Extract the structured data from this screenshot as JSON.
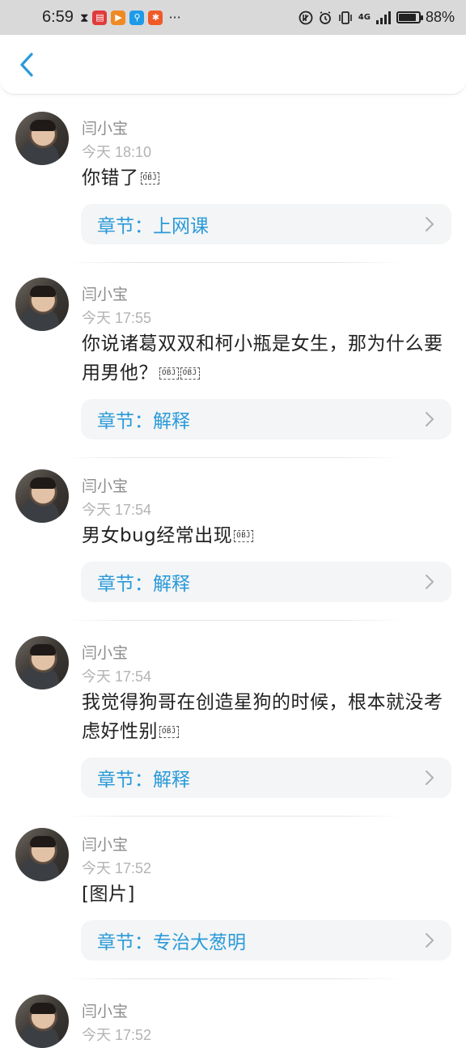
{
  "status_bar": {
    "time": "6:59",
    "app_icons": [
      {
        "name": "hourglass-icon",
        "color": "#222222"
      },
      {
        "name": "book-app-icon",
        "color": "#e03b3b"
      },
      {
        "name": "video-app-icon",
        "color": "#f08a24"
      },
      {
        "name": "search-app-icon",
        "color": "#1e9be8"
      },
      {
        "name": "game-app-icon",
        "color": "#f05a28"
      }
    ],
    "more": "···",
    "network": "4G",
    "battery_percent": "88%",
    "battery_level": 0.88
  },
  "header": {
    "back_icon": "chevron-left-icon",
    "accent_color": "#2a9ad9"
  },
  "comments": [
    {
      "user": "闫小宝",
      "time": "今天 18:10",
      "message": "你错了",
      "obj_count": 1,
      "chapter": "章节：上网课"
    },
    {
      "user": "闫小宝",
      "time": "今天 17:55",
      "message": "你说诸葛双双和柯小瓶是女生，那为什么要用男他？",
      "obj_count": 2,
      "chapter": "章节：解释"
    },
    {
      "user": "闫小宝",
      "time": "今天 17:54",
      "message": "男女bug经常出现",
      "obj_count": 1,
      "chapter": "章节：解释"
    },
    {
      "user": "闫小宝",
      "time": "今天 17:54",
      "message": "我觉得狗哥在创造星狗的时候，根本就没考虑好性别",
      "obj_count": 1,
      "chapter": "章节：解释"
    },
    {
      "user": "闫小宝",
      "time": "今天 17:52",
      "message": "[图片]",
      "obj_count": 0,
      "chapter": "章节：专治大葱明"
    },
    {
      "user": "闫小宝",
      "time": "今天 17:52",
      "message": "",
      "obj_count": 0,
      "chapter": ""
    }
  ],
  "obj_placeholder": "OBJ"
}
